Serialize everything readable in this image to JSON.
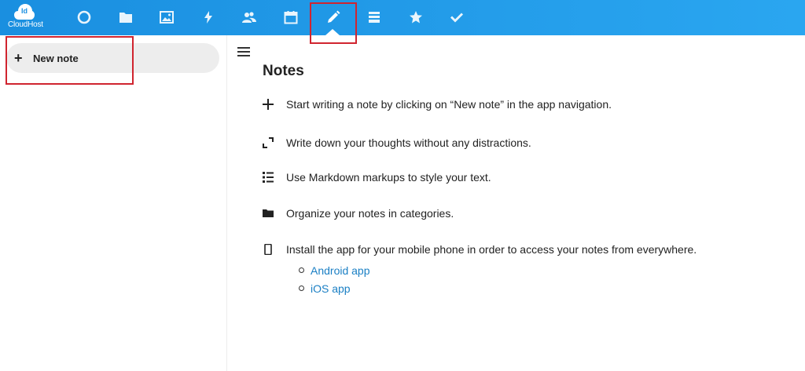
{
  "header": {
    "logo_mono": "Id",
    "logo_text": "CloudHost",
    "apps": [
      {
        "name": "dashboard-icon"
      },
      {
        "name": "files-icon"
      },
      {
        "name": "photos-icon"
      },
      {
        "name": "activity-icon"
      },
      {
        "name": "contacts-icon"
      },
      {
        "name": "calendar-icon"
      },
      {
        "name": "notes-icon",
        "active": true
      },
      {
        "name": "deck-icon"
      },
      {
        "name": "bookmarks-icon"
      },
      {
        "name": "tasks-icon"
      }
    ],
    "accent": "#1a8fe0"
  },
  "sidebar": {
    "new_note_label": "New note"
  },
  "main": {
    "title": "Notes",
    "features": [
      {
        "icon": "plus-icon",
        "text": "Start writing a note by clicking on “New note” in the app navigation."
      },
      {
        "icon": "fullscreen-icon",
        "text": "Write down your thoughts without any distractions."
      },
      {
        "icon": "list-icon",
        "text": "Use Markdown markups to style your text."
      },
      {
        "icon": "folder-icon",
        "text": "Organize your notes in categories."
      },
      {
        "icon": "phone-icon",
        "text": "Install the app for your mobile phone in order to access your notes from everywhere."
      }
    ],
    "links": [
      {
        "label": "Android app"
      },
      {
        "label": "iOS app"
      }
    ]
  }
}
